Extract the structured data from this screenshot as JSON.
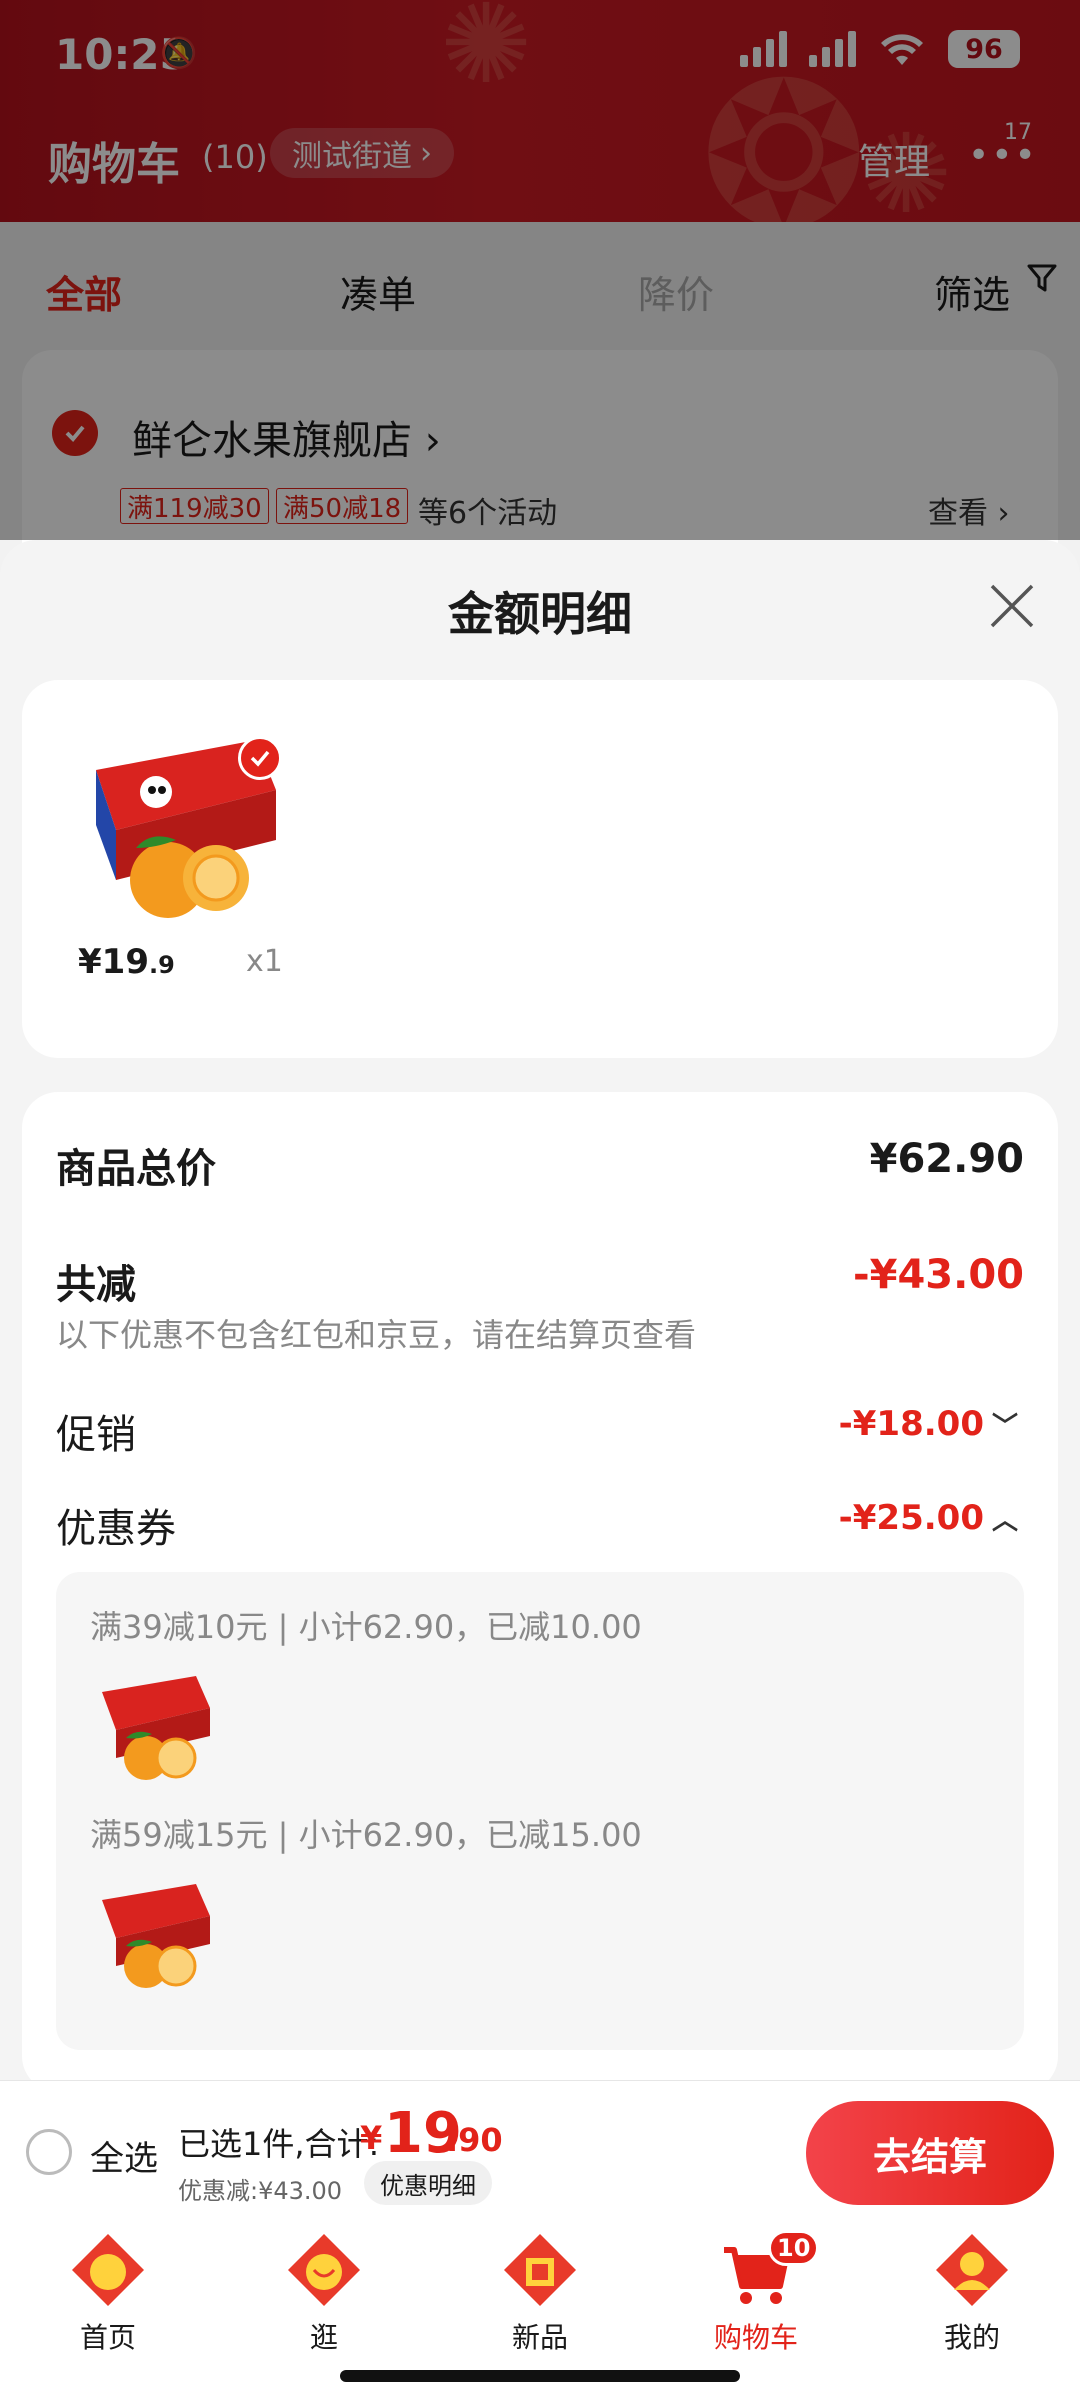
{
  "status_bar": {
    "time": "10:25",
    "battery": "96"
  },
  "header": {
    "title": "购物车",
    "count": "(10)",
    "address": "测试街道",
    "manage": "管理",
    "more_badge": "17"
  },
  "filter_tabs": [
    {
      "label": "全部"
    },
    {
      "label": "凑单"
    },
    {
      "label": "降价"
    },
    {
      "label": "筛选"
    }
  ],
  "store": {
    "name": "鲜仑水果旗舰店",
    "promos": [
      "满119减30",
      "满50减18"
    ],
    "promo_more": "等6个活动",
    "view": "查看"
  },
  "sheet": {
    "title": "金额明细",
    "product": {
      "price_int": "¥19",
      "price_dec": ".9",
      "qty": "x1"
    },
    "total_label": "商品总价",
    "total_value": "¥62.90",
    "discount_label": "共减",
    "discount_value": "-¥43.00",
    "discount_note": "以下优惠不包含红包和京豆，请在结算页查看",
    "promo_label": "促销",
    "promo_value": "-¥18.00",
    "coupon_label": "优惠券",
    "coupon_value": "-¥25.00",
    "coupon_lines": [
      "满39减10元 | 小计62.90，已减10.00",
      "满59减15元 | 小计62.90，已减15.00"
    ]
  },
  "checkout": {
    "select_all": "全选",
    "summary": "已选1件,合计:",
    "currency": "¥",
    "total_int": "19",
    "total_dec": ".90",
    "discount": "优惠减:¥43.00",
    "detail_btn": "优惠明细",
    "button": "去结算"
  },
  "tabbar": {
    "items": [
      {
        "label": "首页"
      },
      {
        "label": "逛"
      },
      {
        "label": "新品"
      },
      {
        "label": "购物车"
      },
      {
        "label": "我的"
      }
    ],
    "cart_badge": "10"
  },
  "colors": {
    "brand": "#e2231a",
    "header": "#c4161f"
  }
}
